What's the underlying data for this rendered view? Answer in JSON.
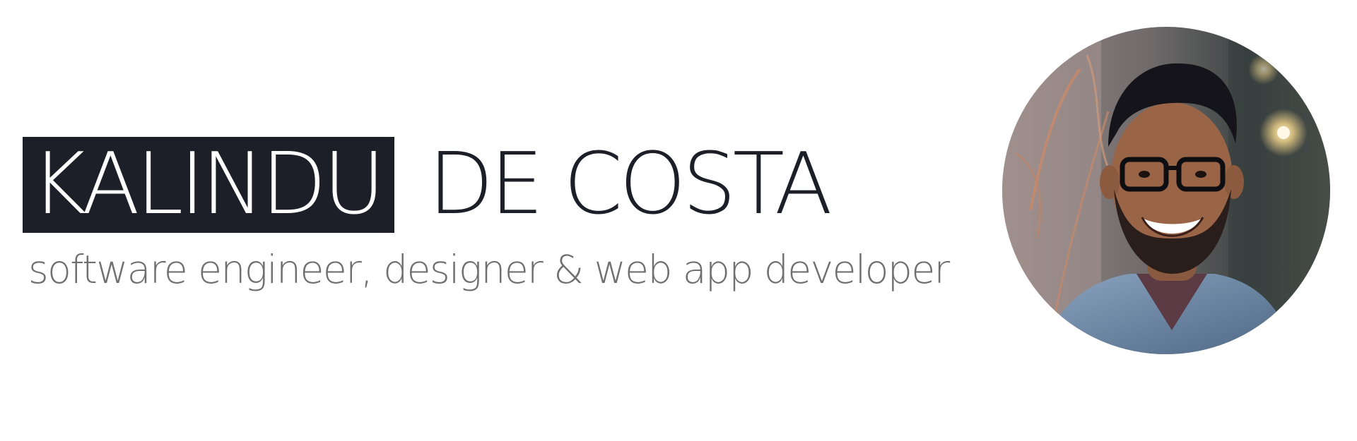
{
  "header": {
    "first_name": "KALINDU",
    "last_name": "DE COSTA",
    "tagline": "software engineer, designer & web app developer"
  },
  "colors": {
    "ink": "#1c1f27",
    "tagline": "#6f6f6f",
    "background": "#ffffff"
  }
}
